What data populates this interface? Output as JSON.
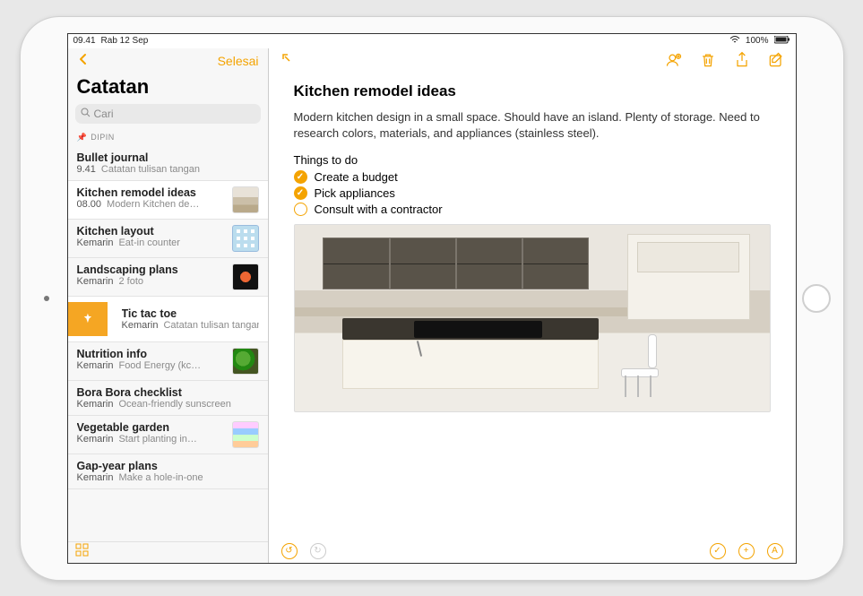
{
  "status_bar": {
    "time": "09.41",
    "date": "Rab 12 Sep",
    "battery": "100%"
  },
  "sidebar": {
    "done_label": "Selesai",
    "title": "Catatan",
    "search_placeholder": "Cari",
    "pinned_header": "DIPIN",
    "items": [
      {
        "title": "Bullet journal",
        "time": "9.41",
        "preview": "Catatan tulisan tangan",
        "thumb": null
      },
      {
        "title": "Kitchen remodel ideas",
        "time": "08.00",
        "preview": "Modern Kitchen de…",
        "thumb": "kitchen"
      },
      {
        "title": "Kitchen layout",
        "time": "Kemarin",
        "preview": "Eat-in counter",
        "thumb": "layout"
      },
      {
        "title": "Landscaping plans",
        "time": "Kemarin",
        "preview": "2 foto",
        "thumb": "flower"
      },
      {
        "title": "Tic tac toe",
        "time": "Kemarin",
        "preview": "Catatan tulisan tangan",
        "thumb": null,
        "shifted": true
      },
      {
        "title": "Nutrition info",
        "time": "Kemarin",
        "preview": "Food Energy (kc…",
        "thumb": "broccoli"
      },
      {
        "title": "Bora Bora checklist",
        "time": "Kemarin",
        "preview": "Ocean-friendly sunscreen",
        "thumb": null
      },
      {
        "title": "Vegetable garden",
        "time": "Kemarin",
        "preview": "Start planting in…",
        "thumb": "garden"
      },
      {
        "title": "Gap-year plans",
        "time": "Kemarin",
        "preview": "Make a hole-in-one",
        "thumb": null
      }
    ]
  },
  "note": {
    "title": "Kitchen remodel ideas",
    "description": "Modern kitchen design in a small space. Should have an island. Plenty of storage. Need to research colors, materials, and appliances (stainless steel).",
    "todo_header": "Things to do",
    "todos": [
      {
        "text": "Create a budget",
        "done": true
      },
      {
        "text": "Pick appliances",
        "done": true
      },
      {
        "text": "Consult with a contractor",
        "done": false
      }
    ]
  },
  "icons": {
    "undo": "↺",
    "redo": "↻",
    "check": "✓",
    "plus": "+",
    "marker": "A"
  }
}
